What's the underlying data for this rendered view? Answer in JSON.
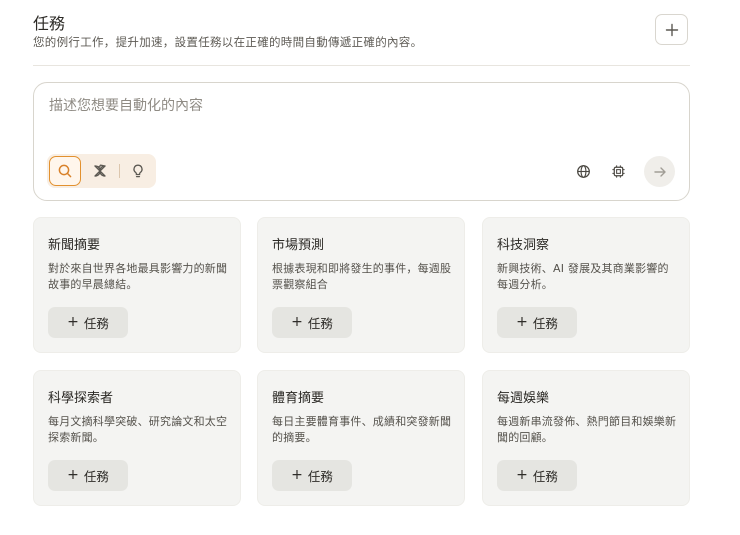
{
  "header": {
    "title": "任務",
    "subtitle": "您的例行工作，提升加速，設置任務以在正確的時間自動傳遞正確的內容。",
    "add_icon": "plus-icon"
  },
  "composer": {
    "placeholder": "描述您想要自動化的內容",
    "modes": [
      {
        "icon": "search-icon",
        "active": true
      },
      {
        "icon": "sparkle-icon",
        "active": false
      },
      {
        "icon": "lightbulb-icon",
        "active": false
      }
    ],
    "tools": [
      "globe-icon",
      "chip-icon"
    ],
    "send_icon": "arrow-right-icon"
  },
  "colors": {
    "accent": "#e2912f",
    "card_bg": "#f4f4f2",
    "button_bg": "#e5e5e1",
    "mode_bar_bg": "#f8eee3"
  },
  "cards": [
    {
      "title": "新聞摘要",
      "desc": "對於來自世界各地最具影響力的新聞故事的早晨總結。",
      "button_plus": "+",
      "button_label": "任務"
    },
    {
      "title": "市場預測",
      "desc": "根據表現和即將發生的事件，每週股票觀察組合",
      "button_plus": "+",
      "button_label": "任務"
    },
    {
      "title": "科技洞察",
      "desc": "新興技術、AI 發展及其商業影響的每週分析。",
      "button_plus": "+",
      "button_label": "任務"
    },
    {
      "title": "科學探索者",
      "desc": "每月文摘科學突破、研究論文和太空探索新聞。",
      "button_plus": "+",
      "button_label": "任務"
    },
    {
      "title": "體育摘要",
      "desc": "每日主要體育事件、成績和突發新聞的摘要。",
      "button_plus": "+",
      "button_label": "任務"
    },
    {
      "title": "每週娛樂",
      "desc": "每週新串流發佈、熱門節目和娛樂新聞的回顧。",
      "button_plus": "+",
      "button_label": "任務"
    }
  ]
}
